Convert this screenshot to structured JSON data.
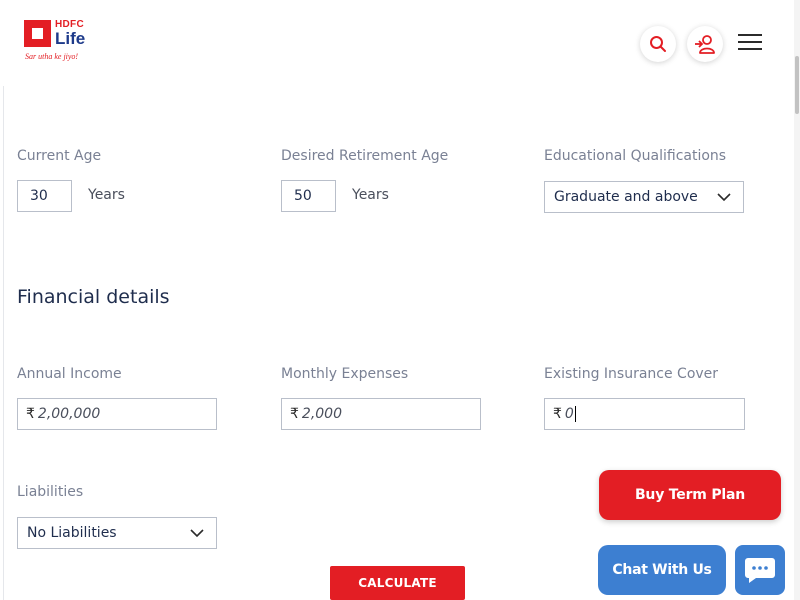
{
  "brand": {
    "name_top": "HDFC",
    "name_bottom": "Life",
    "tagline": "Sar utha ke jiyo!",
    "accent_color": "#e31e24",
    "navy_color": "#1d3a8a"
  },
  "header": {
    "icons": [
      "search-icon",
      "add-user-icon",
      "hamburger-menu-icon"
    ]
  },
  "personal": {
    "current_age": {
      "label": "Current Age",
      "value": "30",
      "unit": "Years"
    },
    "retirement_age": {
      "label": "Desired Retirement Age",
      "value": "50",
      "unit": "Years"
    },
    "education": {
      "label": "Educational Qualifications",
      "selected": "Graduate and above"
    }
  },
  "financial": {
    "title": "Financial details",
    "currency_symbol": "₹",
    "annual_income": {
      "label": "Annual Income",
      "value": "2,00,000"
    },
    "monthly_expenses": {
      "label": "Monthly Expenses",
      "value": "2,000"
    },
    "insurance_cover": {
      "label": "Existing Insurance Cover",
      "value": "0"
    },
    "liabilities": {
      "label": "Liabilities",
      "selected": "No Liabilities"
    }
  },
  "actions": {
    "calculate_label": "CALCULATE",
    "buy_label": "Buy Term Plan",
    "chat_label": "Chat With Us"
  },
  "colors": {
    "red": "#e31e24",
    "chat_blue": "#3d7fd1"
  }
}
